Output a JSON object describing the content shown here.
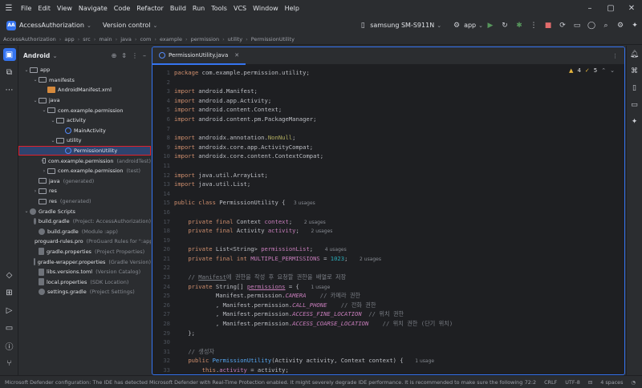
{
  "menu": [
    "File",
    "Edit",
    "View",
    "Navigate",
    "Code",
    "Refactor",
    "Build",
    "Run",
    "Tools",
    "VCS",
    "Window",
    "Help"
  ],
  "toolbar": {
    "project_badge": "AA",
    "project_name": "AccessAuthorization",
    "vcs": "Version control",
    "device": "samsung SM-S911N",
    "run_config": "app"
  },
  "breadcrumb": [
    "AccessAuthorization",
    "app",
    "src",
    "main",
    "java",
    "com",
    "example",
    "permission",
    "utility",
    "PermissionUtility"
  ],
  "project_panel": {
    "title": "Android",
    "tree": [
      {
        "indent": 0,
        "arrow": "⌄",
        "icon": "folder",
        "label": "app",
        "hint": ""
      },
      {
        "indent": 1,
        "arrow": "⌄",
        "icon": "folder",
        "label": "manifests",
        "hint": ""
      },
      {
        "indent": 2,
        "arrow": "",
        "icon": "xml",
        "label": "AndroidManifest.xml",
        "hint": ""
      },
      {
        "indent": 1,
        "arrow": "⌄",
        "icon": "folder",
        "label": "java",
        "hint": ""
      },
      {
        "indent": 2,
        "arrow": "⌄",
        "icon": "folder",
        "label": "com.example.permission",
        "hint": ""
      },
      {
        "indent": 3,
        "arrow": "⌄",
        "icon": "folder",
        "label": "activity",
        "hint": ""
      },
      {
        "indent": 4,
        "arrow": "",
        "icon": "java",
        "label": "MainActivity",
        "hint": ""
      },
      {
        "indent": 3,
        "arrow": "⌄",
        "icon": "folder",
        "label": "utility",
        "hint": ""
      },
      {
        "indent": 4,
        "arrow": "",
        "icon": "java",
        "label": "PermissionUtility",
        "hint": "",
        "selected": true
      },
      {
        "indent": 2,
        "arrow": "›",
        "icon": "folder",
        "label": "com.example.permission",
        "hint": "(androidTest)",
        "green": true
      },
      {
        "indent": 2,
        "arrow": "›",
        "icon": "folder",
        "label": "com.example.permission",
        "hint": "(test)",
        "green": true
      },
      {
        "indent": 1,
        "arrow": "",
        "icon": "folder",
        "label": "java",
        "hint": "(generated)"
      },
      {
        "indent": 1,
        "arrow": "›",
        "icon": "folder",
        "label": "res",
        "hint": ""
      },
      {
        "indent": 1,
        "arrow": "",
        "icon": "folder",
        "label": "res",
        "hint": "(generated)"
      },
      {
        "indent": 0,
        "arrow": "⌄",
        "icon": "gradle",
        "label": "Gradle Scripts",
        "hint": ""
      },
      {
        "indent": 1,
        "arrow": "",
        "icon": "gradle",
        "label": "build.gradle",
        "hint": "(Project: AccessAuthorization)"
      },
      {
        "indent": 1,
        "arrow": "",
        "icon": "gradle",
        "label": "build.gradle",
        "hint": "(Module :app)"
      },
      {
        "indent": 1,
        "arrow": "",
        "icon": "file",
        "label": "proguard-rules.pro",
        "hint": "(ProGuard Rules for \":app\")"
      },
      {
        "indent": 1,
        "arrow": "",
        "icon": "file",
        "label": "gradle.properties",
        "hint": "(Project Properties)"
      },
      {
        "indent": 1,
        "arrow": "",
        "icon": "file",
        "label": "gradle-wrapper.properties",
        "hint": "(Gradle Version)"
      },
      {
        "indent": 1,
        "arrow": "",
        "icon": "file",
        "label": "libs.versions.toml",
        "hint": "(Version Catalog)"
      },
      {
        "indent": 1,
        "arrow": "",
        "icon": "file",
        "label": "local.properties",
        "hint": "(SDK Location)"
      },
      {
        "indent": 1,
        "arrow": "",
        "icon": "gradle",
        "label": "settings.gradle",
        "hint": "(Project Settings)"
      }
    ]
  },
  "editor": {
    "tab_label": "PermissionUtility.java",
    "warnings": "4",
    "weak_warnings": "5",
    "lines": [
      {
        "n": "1",
        "html": "<span class=kw>package</span> com.example.permission.utility;"
      },
      {
        "n": "2",
        "html": ""
      },
      {
        "n": "3",
        "html": "<span class=kw>import</span> android.Manifest;"
      },
      {
        "n": "4",
        "html": "<span class=kw>import</span> android.app.Activity;"
      },
      {
        "n": "5",
        "html": "<span class=kw>import</span> android.content.Context;"
      },
      {
        "n": "6",
        "html": "<span class=kw>import</span> android.content.pm.PackageManager;"
      },
      {
        "n": "7",
        "html": ""
      },
      {
        "n": "8",
        "html": "<span class=kw>import</span> androidx.annotation.<span class=ann>NonNull</span>;"
      },
      {
        "n": "9",
        "html": "<span class=kw>import</span> androidx.core.app.ActivityCompat;"
      },
      {
        "n": "10",
        "html": "<span class=kw>import</span> androidx.core.content.ContextCompat;"
      },
      {
        "n": "11",
        "html": ""
      },
      {
        "n": "12",
        "html": "<span class=kw>import</span> java.util.ArrayList;"
      },
      {
        "n": "13",
        "html": "<span class=kw>import</span> java.util.List;"
      },
      {
        "n": "14",
        "html": ""
      },
      {
        "n": "15",
        "html": "<span class=kw>public class</span> PermissionUtility { <span class=uh>3 usages</span>"
      },
      {
        "n": "16",
        "html": ""
      },
      {
        "n": "17",
        "html": "    <span class=kw>private final</span> Context <span class=fld>context</span>;  <span class=uh>2 usages</span>"
      },
      {
        "n": "18",
        "html": "    <span class=kw>private final</span> Activity <span class=fld>activity</span>;  <span class=uh>2 usages</span>"
      },
      {
        "n": "19",
        "html": ""
      },
      {
        "n": "20",
        "html": "    <span class=kw>private</span> List&lt;String&gt; <span class=fld>permissionList</span>;  <span class=uh>4 usages</span>"
      },
      {
        "n": "21",
        "html": "    <span class=kw>private final int</span> <span class=fld>MULTIPLE_PERMISSIONS</span> = <span class=num>1023</span>;  <span class=uh>2 usages</span>"
      },
      {
        "n": "22",
        "html": ""
      },
      {
        "n": "23",
        "html": "    <span class=cm>// <u>Manifest</u>에 권한을 작성 후 요청할 권한을 배열로 저장</span>"
      },
      {
        "n": "24",
        "html": "    <span class=kw>private</span> String[] <span class=fld><u>permissions</u></span> = {  <span class=uh>1 usage</span>"
      },
      {
        "n": "25",
        "html": "            Manifest.permission.<span class=st>CAMERA</span>    <span class=cm>// 카메라 권한</span>"
      },
      {
        "n": "26",
        "html": "            , Manifest.permission.<span class=st>CALL_PHONE</span>    <span class=cm>// 전화 권한</span>"
      },
      {
        "n": "27",
        "html": "            , Manifest.permission.<span class=st>ACCESS_FINE_LOCATION</span>  <span class=cm>// 위치 권한</span>"
      },
      {
        "n": "28",
        "html": "            , Manifest.permission.<span class=st>ACCESS_COARSE_LOCATION</span>    <span class=cm>// 위치 권한 (단기 위치)</span>"
      },
      {
        "n": "29",
        "html": "    };"
      },
      {
        "n": "30",
        "html": ""
      },
      {
        "n": "31",
        "html": "    <span class=cm>// 생성자</span>"
      },
      {
        "n": "32",
        "html": "    <span class=kw>public</span> <span class=fn>PermissionUtility</span>(Activity activity, Context context) {  <span class=uh>1 usage</span>"
      },
      {
        "n": "33",
        "html": "        <span class=kw>this</span>.<span class=fld>activity</span> = activity;"
      }
    ]
  },
  "status": {
    "message": "Microsoft Defender configuration: The IDE has detected Microsoft Defender with Real-Time Protection enabled. It might severely degrade IDE performance. It is recommended to make sure the following p... (5 minutes ago)",
    "position": "72:2",
    "line_sep": "CRLF",
    "encoding": "UTF-8",
    "indent": "4 spaces"
  }
}
